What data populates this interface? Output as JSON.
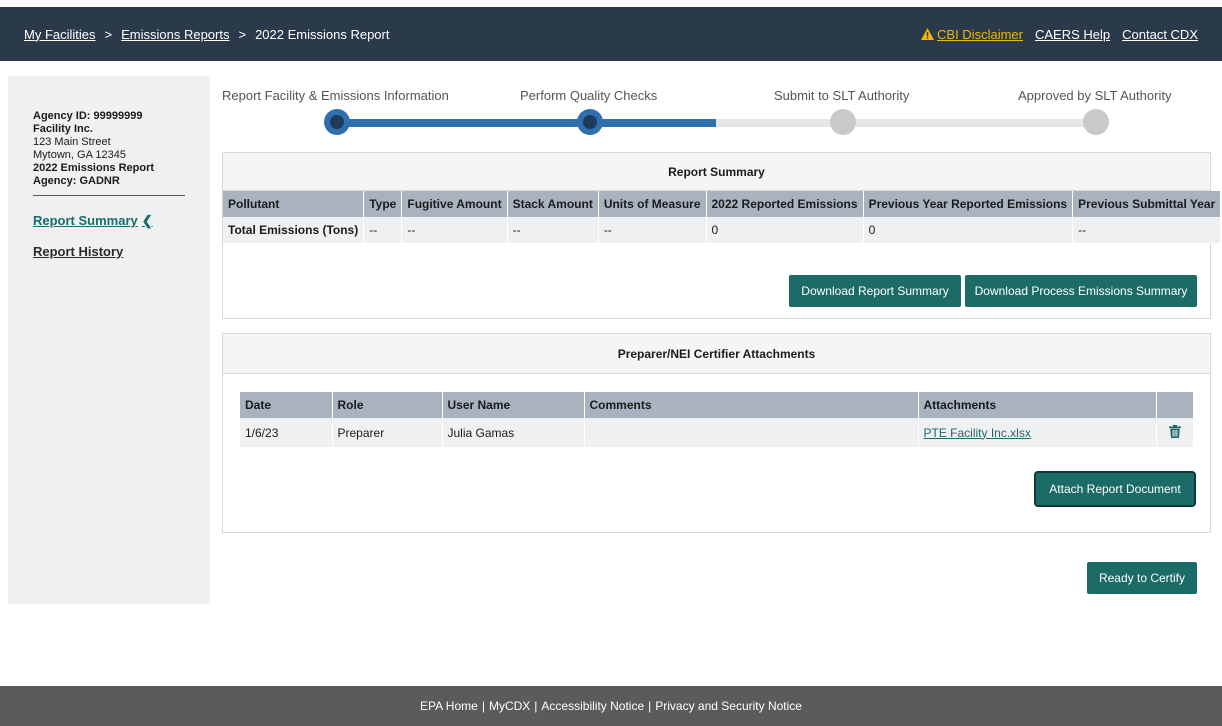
{
  "header": {
    "breadcrumbs": [
      "My Facilities",
      "Emissions Reports",
      "2022 Emissions Report"
    ],
    "separator": ">",
    "links": {
      "cbi": "CBI Disclaimer",
      "help": "CAERS Help",
      "contact": "Contact CDX"
    },
    "colors": {
      "bar": "#2b3a4a",
      "cbi": "#f2b705"
    }
  },
  "sidebar": {
    "agency_id": "Agency ID: 99999999",
    "facility": "Facility Inc.",
    "street": "123 Main Street",
    "city": "Mytown, GA 12345",
    "report": "2022 Emissions Report",
    "agency": "Agency: GADNR",
    "nav": [
      {
        "label": "Report Summary",
        "active": true
      },
      {
        "label": "Report History",
        "active": false
      }
    ]
  },
  "steps": [
    {
      "label": "Report Facility & Emissions Information",
      "status": "done"
    },
    {
      "label": "Perform Quality Checks",
      "status": "done"
    },
    {
      "label": "Submit to SLT Authority",
      "status": "pending"
    },
    {
      "label": "Approved by SLT Authority",
      "status": "pending"
    }
  ],
  "summary": {
    "title": "Report Summary",
    "columns": [
      "Pollutant",
      "Type",
      "Fugitive Amount",
      "Stack Amount",
      "Units of Measure",
      "2022 Reported Emissions",
      "Previous Year Reported Emissions",
      "Previous Submittal Year"
    ],
    "row": [
      "Total Emissions (Tons)",
      "--",
      "--",
      "--",
      "--",
      "0",
      "0",
      "--"
    ],
    "download_summary": "Download Report Summary",
    "download_process": "Download Process Emissions Summary"
  },
  "attachments": {
    "title": "Preparer/NEI Certifier Attachments",
    "columns": [
      "Date",
      "Role",
      "User Name",
      "Comments",
      "Attachments",
      ""
    ],
    "rows": [
      {
        "date": "1/6/23",
        "role": "Preparer",
        "user": "Julia Gamas",
        "comments": "",
        "file": "PTE Facility Inc.xlsx",
        "action_icon": "trash-icon"
      }
    ],
    "attach_button": "Attach Report Document"
  },
  "ready_button": "Ready to Certify",
  "footer": {
    "links": [
      "EPA Home",
      "MyCDX",
      "Accessibility Notice",
      "Privacy and Security Notice"
    ],
    "separator": "|"
  },
  "colors": {
    "accent": "#1d6b66",
    "progress": "#2f6fb0",
    "table_header": "#a9b3bd",
    "footer": "#5b5b5b"
  }
}
